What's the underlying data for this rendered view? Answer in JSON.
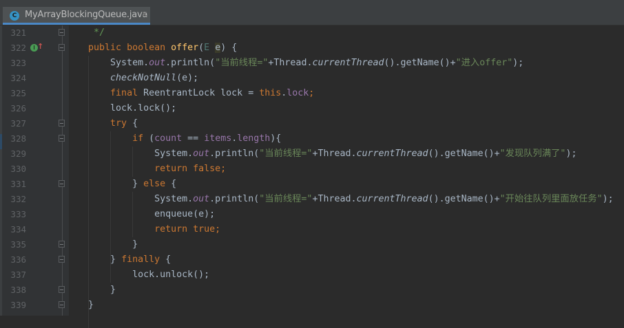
{
  "tab": {
    "label": "MyArrayBlockingQueue.java",
    "icon": "java-class-icon",
    "close": "✕",
    "icon_letter": "C"
  },
  "colors": {
    "keyword": "#cc7832",
    "string": "#6a8759",
    "field": "#9876aa",
    "method_decl": "#ffc66d",
    "text": "#a9b7c6",
    "comment": "#629755",
    "tab_underline": "#4a88c7"
  },
  "lines": [
    {
      "n": "321",
      "fold": true,
      "tokens": [
        [
          "cmt",
          "     */"
        ]
      ]
    },
    {
      "n": "322",
      "fold": true,
      "override": true,
      "tokens": [
        [
          "plain",
          "    "
        ],
        [
          "kw",
          "public boolean "
        ],
        [
          "fn",
          "offer"
        ],
        [
          "plain",
          "("
        ],
        [
          "type",
          "E "
        ],
        [
          "hl",
          "e"
        ],
        [
          "plain",
          ") {"
        ]
      ]
    },
    {
      "n": "323",
      "tokens": [
        [
          "plain",
          "        System."
        ],
        [
          "sfld",
          "out"
        ],
        [
          "plain",
          ".println("
        ],
        [
          "str",
          "\"当前线程=\""
        ],
        [
          "plain",
          "+Thread."
        ],
        [
          "ital",
          "currentThread"
        ],
        [
          "plain",
          "().getName()+"
        ],
        [
          "str",
          "\"进入offer\""
        ],
        [
          "plain",
          ");"
        ]
      ]
    },
    {
      "n": "324",
      "tokens": [
        [
          "plain",
          "        "
        ],
        [
          "ital",
          "checkNotNull"
        ],
        [
          "plain",
          "(e);"
        ]
      ]
    },
    {
      "n": "325",
      "tokens": [
        [
          "plain",
          "        "
        ],
        [
          "kw",
          "final "
        ],
        [
          "plain",
          "ReentrantLock lock = "
        ],
        [
          "kw",
          "this"
        ],
        [
          "plain",
          "."
        ],
        [
          "fld",
          "lock"
        ],
        [
          "kw",
          ";"
        ]
      ]
    },
    {
      "n": "326",
      "tokens": [
        [
          "plain",
          "        lock.lock();"
        ]
      ]
    },
    {
      "n": "327",
      "fold": true,
      "tokens": [
        [
          "plain",
          "        "
        ],
        [
          "kw",
          "try "
        ],
        [
          "plain",
          "{"
        ]
      ]
    },
    {
      "n": "328",
      "fold": true,
      "tokens": [
        [
          "plain",
          "            "
        ],
        [
          "kw",
          "if "
        ],
        [
          "plain",
          "("
        ],
        [
          "fld",
          "count"
        ],
        [
          "plain",
          " == "
        ],
        [
          "fld",
          "items"
        ],
        [
          "plain",
          "."
        ],
        [
          "fld",
          "length"
        ],
        [
          "plain",
          "){"
        ]
      ]
    },
    {
      "n": "329",
      "tokens": [
        [
          "plain",
          "                System."
        ],
        [
          "sfld",
          "out"
        ],
        [
          "plain",
          ".println("
        ],
        [
          "str",
          "\"当前线程=\""
        ],
        [
          "plain",
          "+Thread."
        ],
        [
          "ital",
          "currentThread"
        ],
        [
          "plain",
          "().getName()+"
        ],
        [
          "str",
          "\"发现队列满了\""
        ],
        [
          "plain",
          ");"
        ]
      ]
    },
    {
      "n": "330",
      "tokens": [
        [
          "plain",
          "                "
        ],
        [
          "kw",
          "return false;"
        ]
      ]
    },
    {
      "n": "331",
      "fold": true,
      "tokens": [
        [
          "plain",
          "            } "
        ],
        [
          "kw",
          "else "
        ],
        [
          "plain",
          "{"
        ]
      ]
    },
    {
      "n": "332",
      "tokens": [
        [
          "plain",
          "                System."
        ],
        [
          "sfld",
          "out"
        ],
        [
          "plain",
          ".println("
        ],
        [
          "str",
          "\"当前线程=\""
        ],
        [
          "plain",
          "+Thread."
        ],
        [
          "ital",
          "currentThread"
        ],
        [
          "plain",
          "().getName()+"
        ],
        [
          "str",
          "\"开始往队列里面放任务\""
        ],
        [
          "plain",
          ");"
        ]
      ]
    },
    {
      "n": "333",
      "tokens": [
        [
          "plain",
          "                enqueue(e);"
        ]
      ]
    },
    {
      "n": "334",
      "tokens": [
        [
          "plain",
          "                "
        ],
        [
          "kw",
          "return true;"
        ]
      ]
    },
    {
      "n": "335",
      "fold": true,
      "tokens": [
        [
          "plain",
          "            }"
        ]
      ]
    },
    {
      "n": "336",
      "fold": true,
      "tokens": [
        [
          "plain",
          "        } "
        ],
        [
          "kw",
          "finally "
        ],
        [
          "plain",
          "{"
        ]
      ]
    },
    {
      "n": "337",
      "tokens": [
        [
          "plain",
          "            lock.unlock();"
        ]
      ]
    },
    {
      "n": "338",
      "fold": true,
      "tokens": [
        [
          "plain",
          "        }"
        ]
      ]
    },
    {
      "n": "339",
      "fold": true,
      "tokens": [
        [
          "plain",
          "    }"
        ]
      ]
    }
  ]
}
